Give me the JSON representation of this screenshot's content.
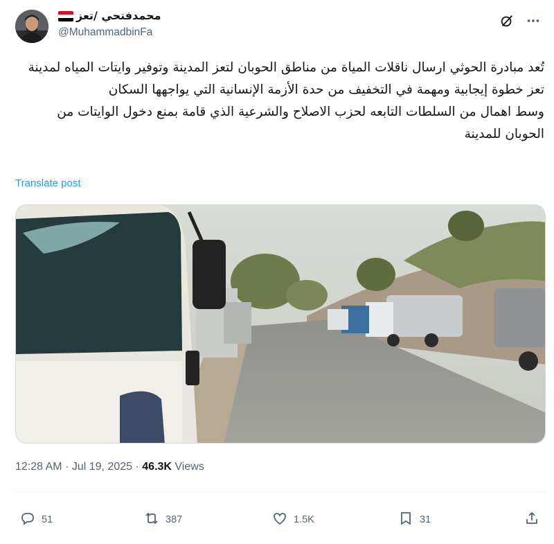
{
  "author": {
    "display_name": "محمدفتحي /تعز",
    "handle": "@MuhammadbinFa"
  },
  "post": {
    "lines": [
      "تُعد مبادرة الحوثي ارسال ناقلات المياة من مناطق الحوبان لتعز المدينة وتوفير وايتات المياه لمدينة تعز خطوة إيجابية ومهمة في التخفيف من حدة الأزمة الإنسانية التي يواجهها السكان",
      "وسط اهمال من السلطات التابعه لحزب الاصلاح والشرعية الذي قامة بمنع دخول الوايتات من الحوبان للمدينة"
    ],
    "translate_label": "Translate post",
    "time": "12:28 AM",
    "date": "Jul 19, 2025",
    "views_count": "46.3K",
    "views_label": "Views"
  },
  "actions": {
    "replies": "51",
    "reposts": "387",
    "likes": "1.5K",
    "bookmarks": "31"
  },
  "icons": [
    "grok-icon",
    "more-icon",
    "reply-icon",
    "repost-icon",
    "like-icon",
    "bookmark-icon",
    "share-icon"
  ],
  "colors": {
    "link": "#1d9bf0",
    "secondary_text": "#536471",
    "primary_text": "#0f1419"
  }
}
